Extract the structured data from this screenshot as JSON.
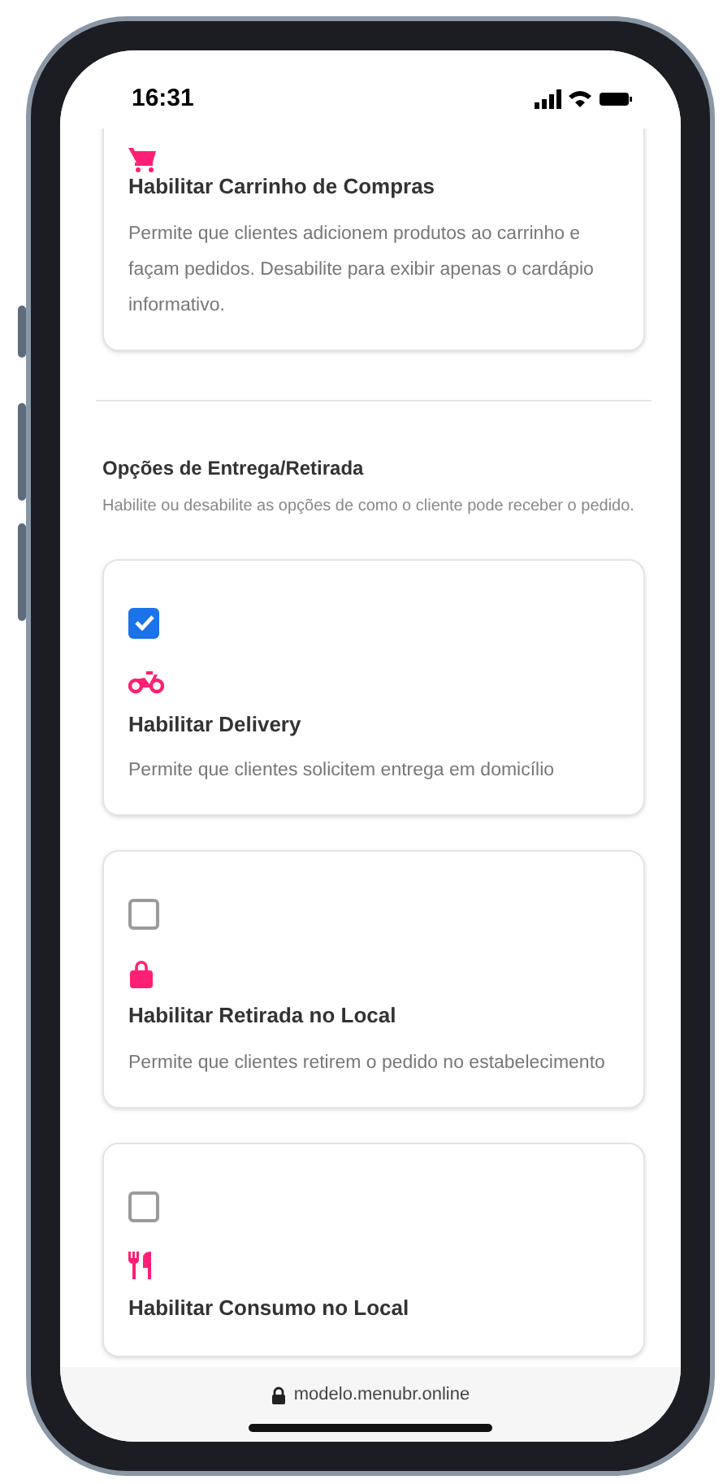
{
  "status_bar": {
    "time": "16:31"
  },
  "cart_option": {
    "kind": "cart",
    "title": "Habilitar Carrinho de Compras",
    "description": "Permite que clientes adicionem produtos ao carrinho e façam pedidos. Desabilite para exibir apenas o cardápio informativo."
  },
  "delivery_section": {
    "title": "Opções de Entrega/Retirada",
    "description": "Habilite ou desabilite as opções de como o cliente pode receber o pedido.",
    "options": [
      {
        "kind": "motorcycle",
        "title": "Habilitar Delivery",
        "description": "Permite que clientes solicitem entrega em domicílio",
        "checked": true
      },
      {
        "kind": "bag",
        "title": "Habilitar Retirada no Local",
        "description": "Permite que clientes retirem o pedido no estabelecimento",
        "checked": false
      },
      {
        "kind": "utensils",
        "title": "Habilitar Consumo no Local",
        "checked": false
      }
    ]
  },
  "browser_bar": {
    "url": "modelo.menubr.online"
  }
}
